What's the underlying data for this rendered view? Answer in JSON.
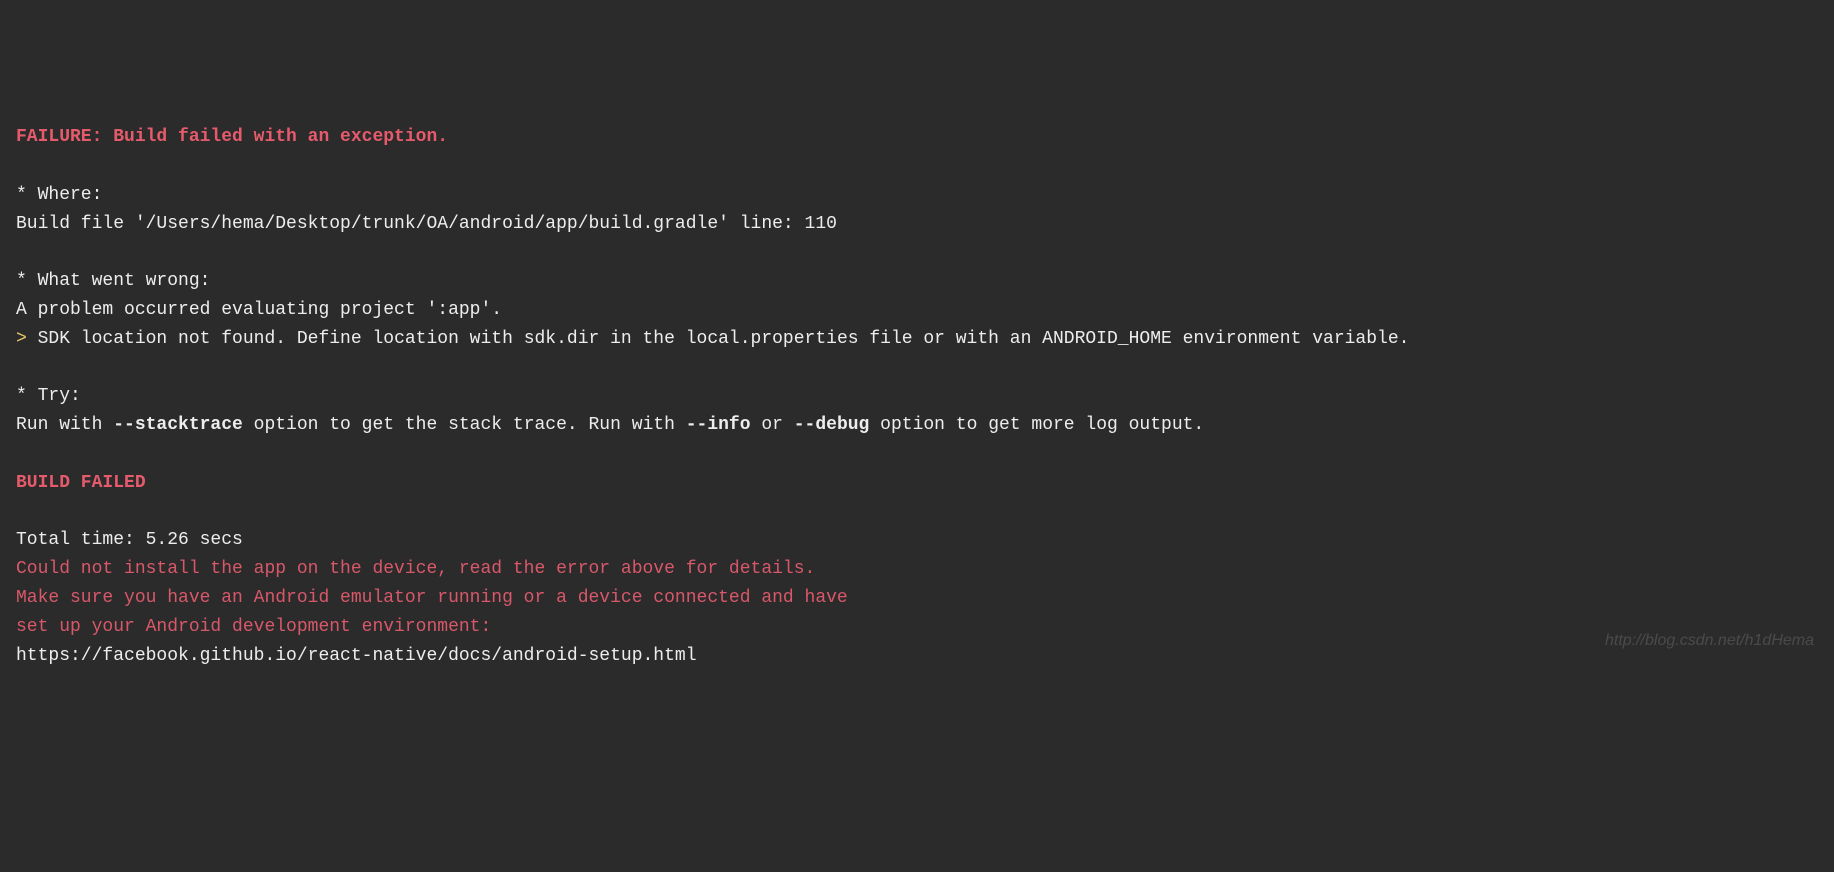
{
  "terminal": {
    "failure_header": "FAILURE: Build failed with an exception.",
    "blank1": "",
    "where_label": "* Where:",
    "where_detail": "Build file '/Users/hema/Desktop/trunk/OA/android/app/build.gradle' line: 110",
    "blank2": "",
    "what_wrong_label": "* What went wrong:",
    "what_wrong_detail": "A problem occurred evaluating project ':app'.",
    "sdk_error_prefix": "> ",
    "sdk_error": "SDK location not found. Define location with sdk.dir in the local.properties file or with an ANDROID_HOME environment variable.",
    "blank3": "",
    "try_label": "* Try:",
    "try_run_with1": "Run with ",
    "try_stacktrace": "--stacktrace",
    "try_option1": " option to get the stack trace. Run with ",
    "try_info": "--info",
    "try_or": " or ",
    "try_debug": "--debug",
    "try_option2": " option to get more log output.",
    "blank4": "",
    "build_failed": "BUILD FAILED",
    "blank5": "",
    "total_time": "Total time: 5.26 secs",
    "install_error1": "Could not install the app on the device, read the error above for details.",
    "install_error2": "Make sure you have an Android emulator running or a device connected and have",
    "install_error3": "set up your Android development environment:",
    "docs_url": "https://facebook.github.io/react-native/docs/android-setup.html"
  },
  "watermark": "http://blog.csdn.net/h1dHema"
}
